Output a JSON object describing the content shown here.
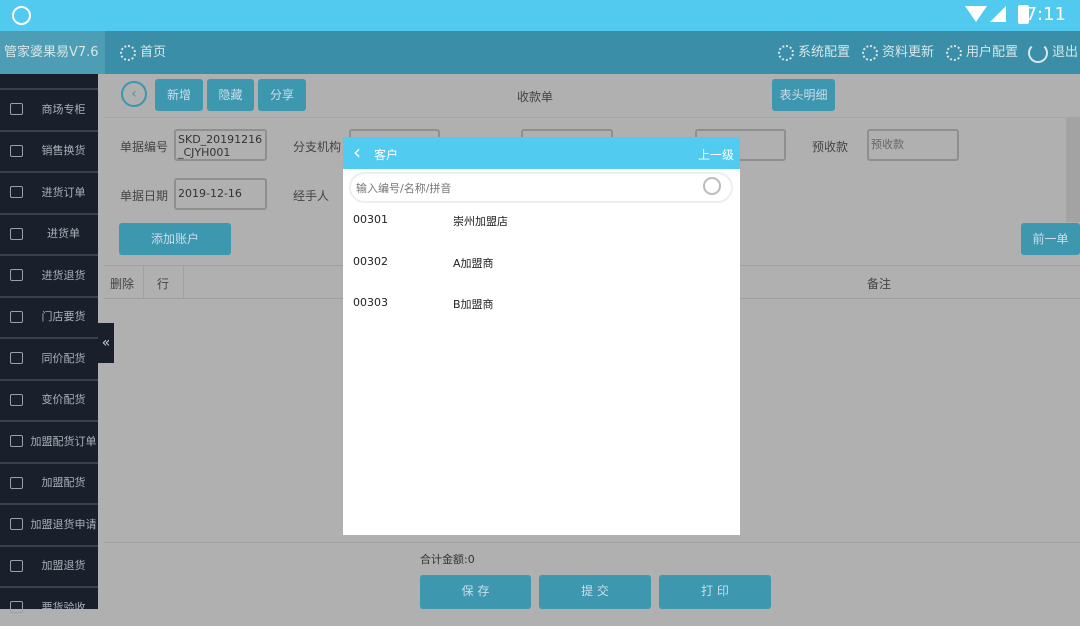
{
  "status": {
    "time": "7:11"
  },
  "header": {
    "brand": "管家婆果易V7.6",
    "home": "首页",
    "system_config": "系统配置",
    "data_update": "资料更新",
    "user_config": "用户配置",
    "logout": "退出"
  },
  "sidebar": {
    "items": [
      {
        "label": "商场专柜"
      },
      {
        "label": "销售换货"
      },
      {
        "label": "进货订单"
      },
      {
        "label": "进货单"
      },
      {
        "label": "进货退货"
      },
      {
        "label": "门店要货"
      },
      {
        "label": "同价配货"
      },
      {
        "label": "变价配货"
      },
      {
        "label": "加盟配货订单"
      },
      {
        "label": "加盟配货"
      },
      {
        "label": "加盟退货申请"
      },
      {
        "label": "加盟退货"
      },
      {
        "label": "要货验收"
      }
    ]
  },
  "toolbar": {
    "add": "新增",
    "hide": "隐藏",
    "share": "分享",
    "title": "收款单",
    "header_detail": "表头明细"
  },
  "form": {
    "doc_no_label": "单据编号",
    "doc_no": "SKD_20191216_CJYH001",
    "branch_label": "分支机构",
    "prepay_label": "预收款",
    "prepay_placeholder": "预收款",
    "date_label": "单据日期",
    "date": "2019-12-16",
    "handler_label": "经手人",
    "add_account": "添加账户",
    "prev": "前一单"
  },
  "table": {
    "headers": {
      "delete": "删除",
      "row": "行",
      "remark": "备注"
    }
  },
  "footer": {
    "total": "合计金额:0",
    "save": "保 存",
    "submit": "提 交",
    "print": "打 印"
  },
  "modal": {
    "title": "客户",
    "up_level": "上一级",
    "search_placeholder": "输入编号/名称/拼音",
    "items": [
      {
        "code": "00301",
        "name": "崇州加盟店"
      },
      {
        "code": "00302",
        "name": "A加盟商"
      },
      {
        "code": "00303",
        "name": "B加盟商"
      }
    ]
  },
  "colors": {
    "accent": "#52cbf0",
    "header": "#3a8ea7",
    "sidebar": "#1a202b"
  }
}
